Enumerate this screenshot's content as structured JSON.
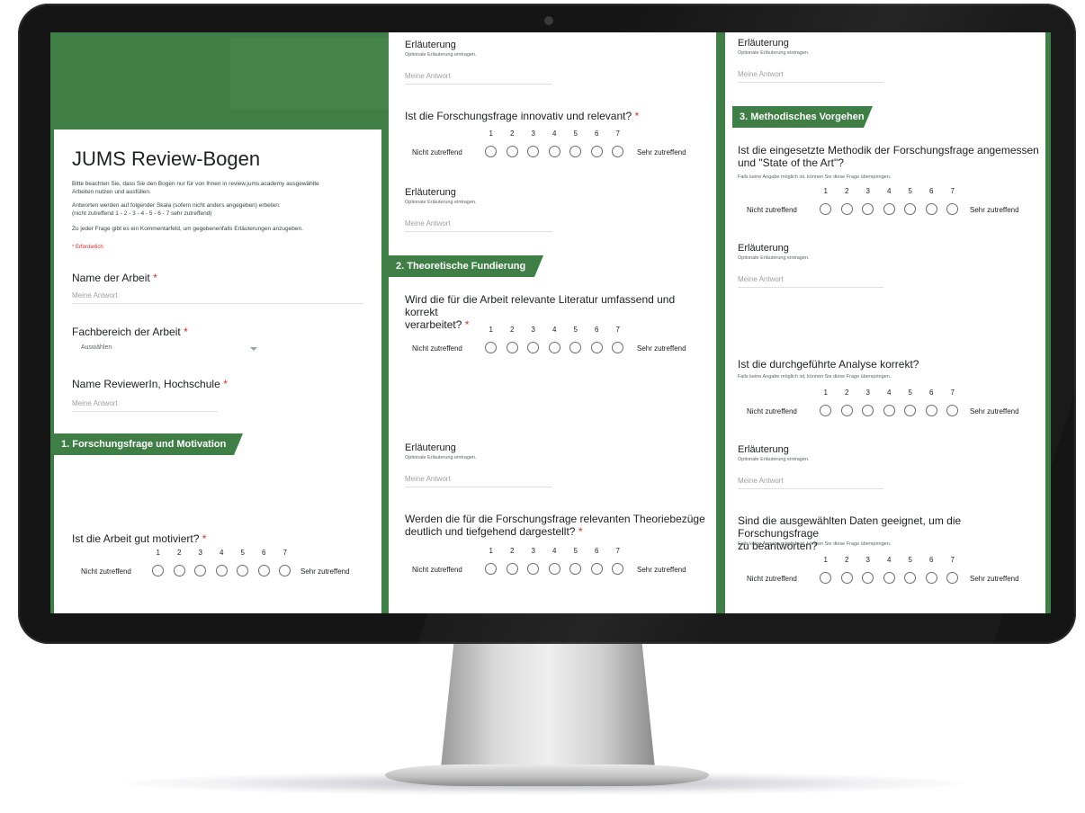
{
  "form": {
    "title": "JUMS Review-Bogen",
    "intro_1": "Bitte beachten Sie, dass Sie den Bogen nur für von Ihnen in review.jums.academy ausgewählte Arbeiten nutzen und ausfüllen.",
    "intro_2": "Antworten werden auf folgender Skala (sofern nicht anders angegeben) erbeten:",
    "intro_3": "(nicht zutreffend 1 - 2 - 3 - 4 - 5 - 6 - 7 sehr zutreffend)",
    "intro_4": "Zu jeder Frage gibt es ein Kommentarfeld, um gegebenenfalls Erläuterungen anzugeben.",
    "required_note": "* Erforderlich",
    "required_star": "*"
  },
  "fields": {
    "name_label": "Name der Arbeit",
    "dept_label": "Fachbereich der Arbeit",
    "dept_select": "Auswählen",
    "reviewer_label": "Name ReviewerIn, Hochschule",
    "answer_placeholder": "Meine Antwort"
  },
  "scale": {
    "numbers": [
      "1",
      "2",
      "3",
      "4",
      "5",
      "6",
      "7"
    ],
    "low_label": "Nicht zutreffend",
    "high_label": "Sehr zutreffend"
  },
  "explanation": {
    "title": "Erläuterung",
    "subtitle": "Optionale Erläuterung eintragen."
  },
  "skip_hint": "Falls keine Angabe möglich ist, können Sie diese Frage überspringen.",
  "sections": {
    "s1": "1. Forschungsfrage und Motivation",
    "s2": "2. Theoretische Fundierung",
    "s3": "3. Methodisches Vorgehen"
  },
  "questions": {
    "q_motivated": "Ist die Arbeit gut motiviert?",
    "q_innovative": "Ist die Forschungsfrage innovativ und relevant?",
    "q_literature_1": "Wird die für die Arbeit relevante Literatur umfassend und korrekt",
    "q_literature_2": "verarbeitet?",
    "q_theory_1": "Werden die für die Forschungsfrage relevanten Theoriebezüge",
    "q_theory_2": "deutlich und tiefgehend dargestellt?",
    "q_method_1": "Ist die eingesetzte Methodik der Forschungsfrage angemessen",
    "q_method_2": "und \"State of the Art\"?",
    "q_analysis": "Ist die durchgeführte Analyse korrekt?",
    "q_data_1": "Sind die ausgewählten Daten geeignet, um die Forschungsfrage",
    "q_data_2": "zu beantworten?"
  }
}
